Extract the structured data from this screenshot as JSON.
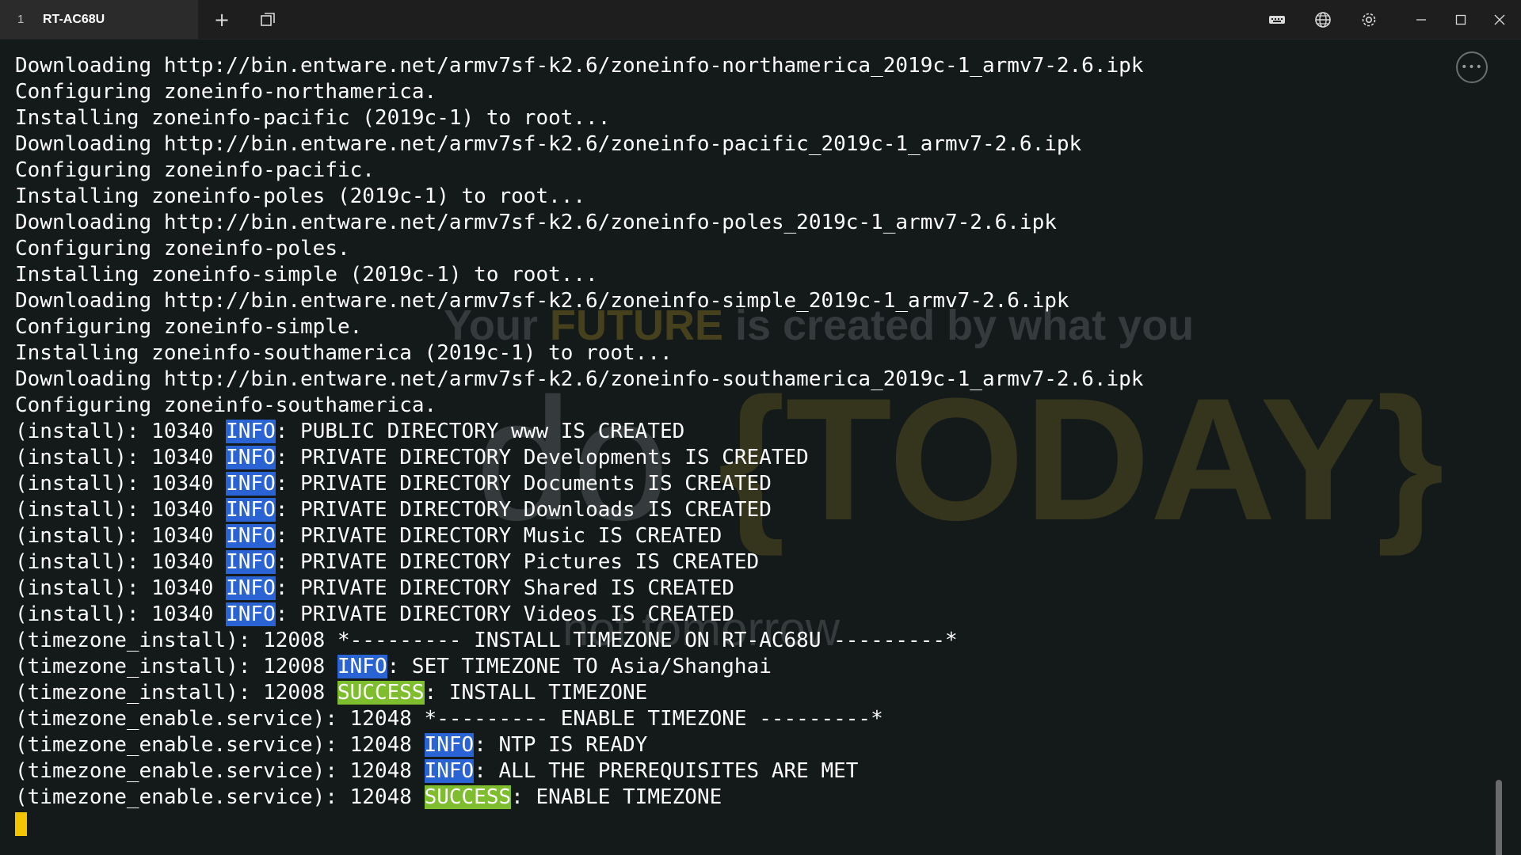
{
  "titlebar": {
    "tab_number": "1",
    "tab_title": "RT-AC68U",
    "new_tab_label": "+"
  },
  "watermark": {
    "line1_a": "Your ",
    "line1_hl": "FUTURE",
    "line1_b": " is created by what you",
    "line2_a": "do ",
    "line2_hl": "{TODAY}",
    "line3": "not tomorrow"
  },
  "menu": {
    "label": "•••"
  },
  "terminal": {
    "lines": [
      {
        "pre": "Downloading http://bin.entware.net/armv7sf-k2.6/zoneinfo-northamerica_2019c-1_armv7-2.6.ipk",
        "tag": "",
        "post": ""
      },
      {
        "pre": "Configuring zoneinfo-northamerica.",
        "tag": "",
        "post": ""
      },
      {
        "pre": "Installing zoneinfo-pacific (2019c-1) to root...",
        "tag": "",
        "post": ""
      },
      {
        "pre": "Downloading http://bin.entware.net/armv7sf-k2.6/zoneinfo-pacific_2019c-1_armv7-2.6.ipk",
        "tag": "",
        "post": ""
      },
      {
        "pre": "Configuring zoneinfo-pacific.",
        "tag": "",
        "post": ""
      },
      {
        "pre": "Installing zoneinfo-poles (2019c-1) to root...",
        "tag": "",
        "post": ""
      },
      {
        "pre": "Downloading http://bin.entware.net/armv7sf-k2.6/zoneinfo-poles_2019c-1_armv7-2.6.ipk",
        "tag": "",
        "post": ""
      },
      {
        "pre": "Configuring zoneinfo-poles.",
        "tag": "",
        "post": ""
      },
      {
        "pre": "Installing zoneinfo-simple (2019c-1) to root...",
        "tag": "",
        "post": ""
      },
      {
        "pre": "Downloading http://bin.entware.net/armv7sf-k2.6/zoneinfo-simple_2019c-1_armv7-2.6.ipk",
        "tag": "",
        "post": ""
      },
      {
        "pre": "Configuring zoneinfo-simple.",
        "tag": "",
        "post": ""
      },
      {
        "pre": "Installing zoneinfo-southamerica (2019c-1) to root...",
        "tag": "",
        "post": ""
      },
      {
        "pre": "Downloading http://bin.entware.net/armv7sf-k2.6/zoneinfo-southamerica_2019c-1_armv7-2.6.ipk",
        "tag": "",
        "post": ""
      },
      {
        "pre": "Configuring zoneinfo-southamerica.",
        "tag": "",
        "post": ""
      },
      {
        "pre": "(install): 10340 ",
        "tag": "INFO",
        "post": ": PUBLIC DIRECTORY www IS CREATED"
      },
      {
        "pre": "(install): 10340 ",
        "tag": "INFO",
        "post": ": PRIVATE DIRECTORY Developments IS CREATED"
      },
      {
        "pre": "(install): 10340 ",
        "tag": "INFO",
        "post": ": PRIVATE DIRECTORY Documents IS CREATED"
      },
      {
        "pre": "(install): 10340 ",
        "tag": "INFO",
        "post": ": PRIVATE DIRECTORY Downloads IS CREATED"
      },
      {
        "pre": "(install): 10340 ",
        "tag": "INFO",
        "post": ": PRIVATE DIRECTORY Music IS CREATED"
      },
      {
        "pre": "(install): 10340 ",
        "tag": "INFO",
        "post": ": PRIVATE DIRECTORY Pictures IS CREATED"
      },
      {
        "pre": "(install): 10340 ",
        "tag": "INFO",
        "post": ": PRIVATE DIRECTORY Shared IS CREATED"
      },
      {
        "pre": "(install): 10340 ",
        "tag": "INFO",
        "post": ": PRIVATE DIRECTORY Videos IS CREATED"
      },
      {
        "pre": "(timezone_install): 12008 *--------- INSTALL TIMEZONE ON RT-AC68U ---------*",
        "tag": "",
        "post": ""
      },
      {
        "pre": "(timezone_install): 12008 ",
        "tag": "INFO",
        "post": ": SET TIMEZONE TO Asia/Shanghai"
      },
      {
        "pre": "(timezone_install): 12008 ",
        "tag": "SUCCESS",
        "post": ": INSTALL TIMEZONE"
      },
      {
        "pre": "(timezone_enable.service): 12048 *--------- ENABLE TIMEZONE ---------*",
        "tag": "",
        "post": ""
      },
      {
        "pre": "(timezone_enable.service): 12048 ",
        "tag": "INFO",
        "post": ": NTP IS READY"
      },
      {
        "pre": "(timezone_enable.service): 12048 ",
        "tag": "INFO",
        "post": ": ALL THE PREREQUISITES ARE MET"
      },
      {
        "pre": "(timezone_enable.service): 12048 ",
        "tag": "SUCCESS",
        "post": ": ENABLE TIMEZONE"
      }
    ]
  },
  "colors": {
    "info": "#2a63d4",
    "success": "#7dbd2e",
    "cursor": "#f2c400",
    "background": "#141a1a"
  },
  "icons": {
    "new_tab": "plus-icon",
    "tabs": "copy-icon",
    "keyboard": "keyboard-icon",
    "globe": "globe-icon",
    "settings": "gear-icon",
    "minimize": "minimize-icon",
    "maximize": "maximize-icon",
    "close": "close-icon",
    "menu": "more-icon"
  }
}
